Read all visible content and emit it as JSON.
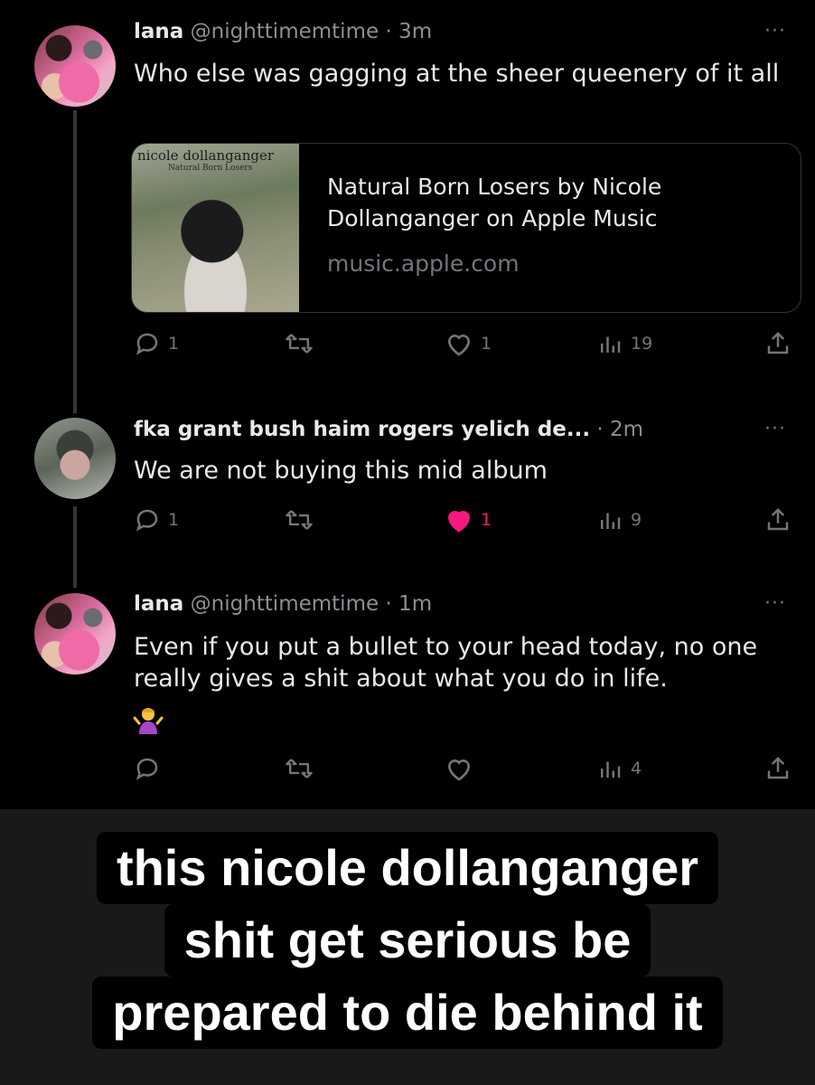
{
  "posts": [
    {
      "name": "lana",
      "handle": "@nighttimemtime",
      "time": "· 3m",
      "text": "Who else was gagging at the sheer queenery of it all",
      "card": {
        "thumb_title": "nicole dollanganger",
        "thumb_subtitle": "Natural Born Losers",
        "title": "Natural Born Losers by Nicole Dollanganger on Apple Music",
        "domain": "music.apple.com"
      },
      "stats": {
        "replies": "1",
        "reposts": "",
        "likes": "1",
        "views": "19"
      },
      "liked": false
    },
    {
      "name": "fka grant bush haim rogers yelich de...",
      "handle": "",
      "time": "· 2m",
      "text": "We are not buying this mid album",
      "stats": {
        "replies": "1",
        "reposts": "",
        "likes": "1",
        "views": "9"
      },
      "liked": true
    },
    {
      "name": "lana",
      "handle": "@nighttimemtime",
      "time": "· 1m",
      "text": "Even if you put a bullet to your head today, no one really gives a shit about what you do in life.",
      "emoji": "woman-shrugging",
      "stats": {
        "replies": "",
        "reposts": "",
        "likes": "",
        "views": "4"
      },
      "liked": false
    }
  ],
  "more_glyph": "···",
  "caption": {
    "lines": [
      "this nicole dollanganger",
      "shit get serious be",
      "prepared to die behind it"
    ]
  },
  "colors": {
    "background": "#000000",
    "muted": "#71767b",
    "like_active": "#f91880",
    "caption_bg": "#000000",
    "caption_text": "#ffffff"
  }
}
